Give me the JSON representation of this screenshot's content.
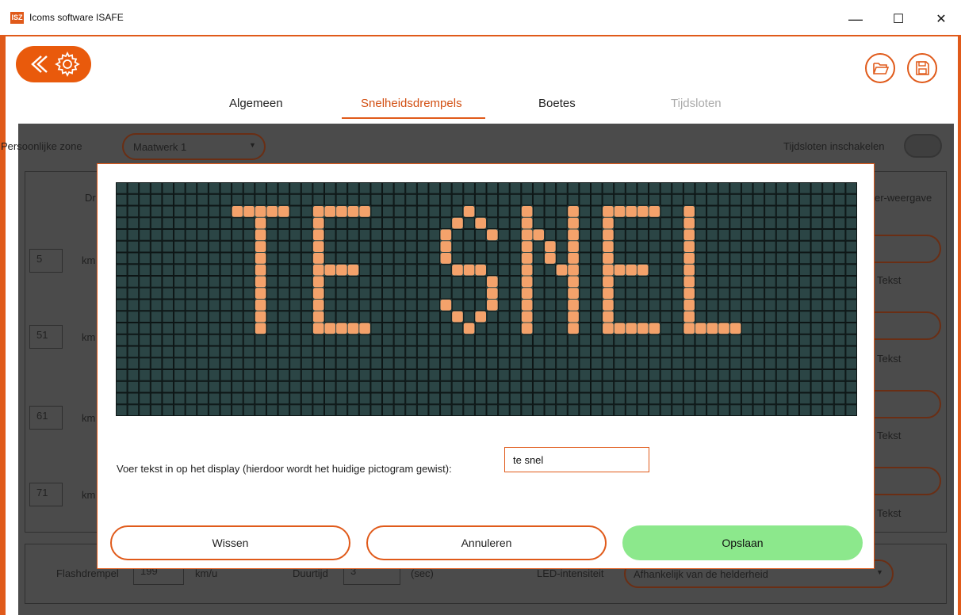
{
  "window": {
    "title": "Icoms software ISAFE",
    "app_icon_text": "ISZ",
    "minimize_glyph": "—",
    "maximize_glyph": "☐",
    "close_glyph": "✕",
    "accent_color": "#e05a1a"
  },
  "tabs": [
    {
      "label": "Algemeen",
      "state": "normal"
    },
    {
      "label": "Snelheidsdrempels",
      "state": "active"
    },
    {
      "label": "Boetes",
      "state": "normal"
    },
    {
      "label": "Tijdsloten",
      "state": "disabled"
    }
  ],
  "background": {
    "zone_label": "Persoonlijke zone",
    "zone_value": "Maatwerk 1",
    "timeslots_label": "Tijdsloten inschakelen",
    "col_header_left": "Dr",
    "col_header_right": "er-weergave",
    "rows": [
      {
        "speed": "5",
        "unit": "km",
        "mode": "Tekst"
      },
      {
        "speed": "51",
        "unit": "km",
        "mode": "Tekst"
      },
      {
        "speed": "61",
        "unit": "km",
        "mode": "Tekst"
      },
      {
        "speed": "71",
        "unit": "km",
        "mode": "Tekst"
      }
    ],
    "flash_label": "Flashdrempel",
    "flash_value": "199",
    "flash_unit": "km/u",
    "duration_label": "Duurtijd",
    "duration_value": "3",
    "duration_unit": "(sec)",
    "led_label": "LED-intensiteit",
    "led_value": "Afhankelijk van de helderheid"
  },
  "dialog": {
    "led_text": "TE SNEL",
    "led_columns": 64,
    "led_rows": 20,
    "led_background": "#2b4545",
    "led_on_color": "#f4a26b",
    "prompt": "Voer tekst in op het display (hierdoor wordt het huidige pictogram gewist):",
    "input_value": "te snel",
    "buttons": {
      "clear": "Wissen",
      "cancel": "Annuleren",
      "save": "Opslaan"
    }
  }
}
